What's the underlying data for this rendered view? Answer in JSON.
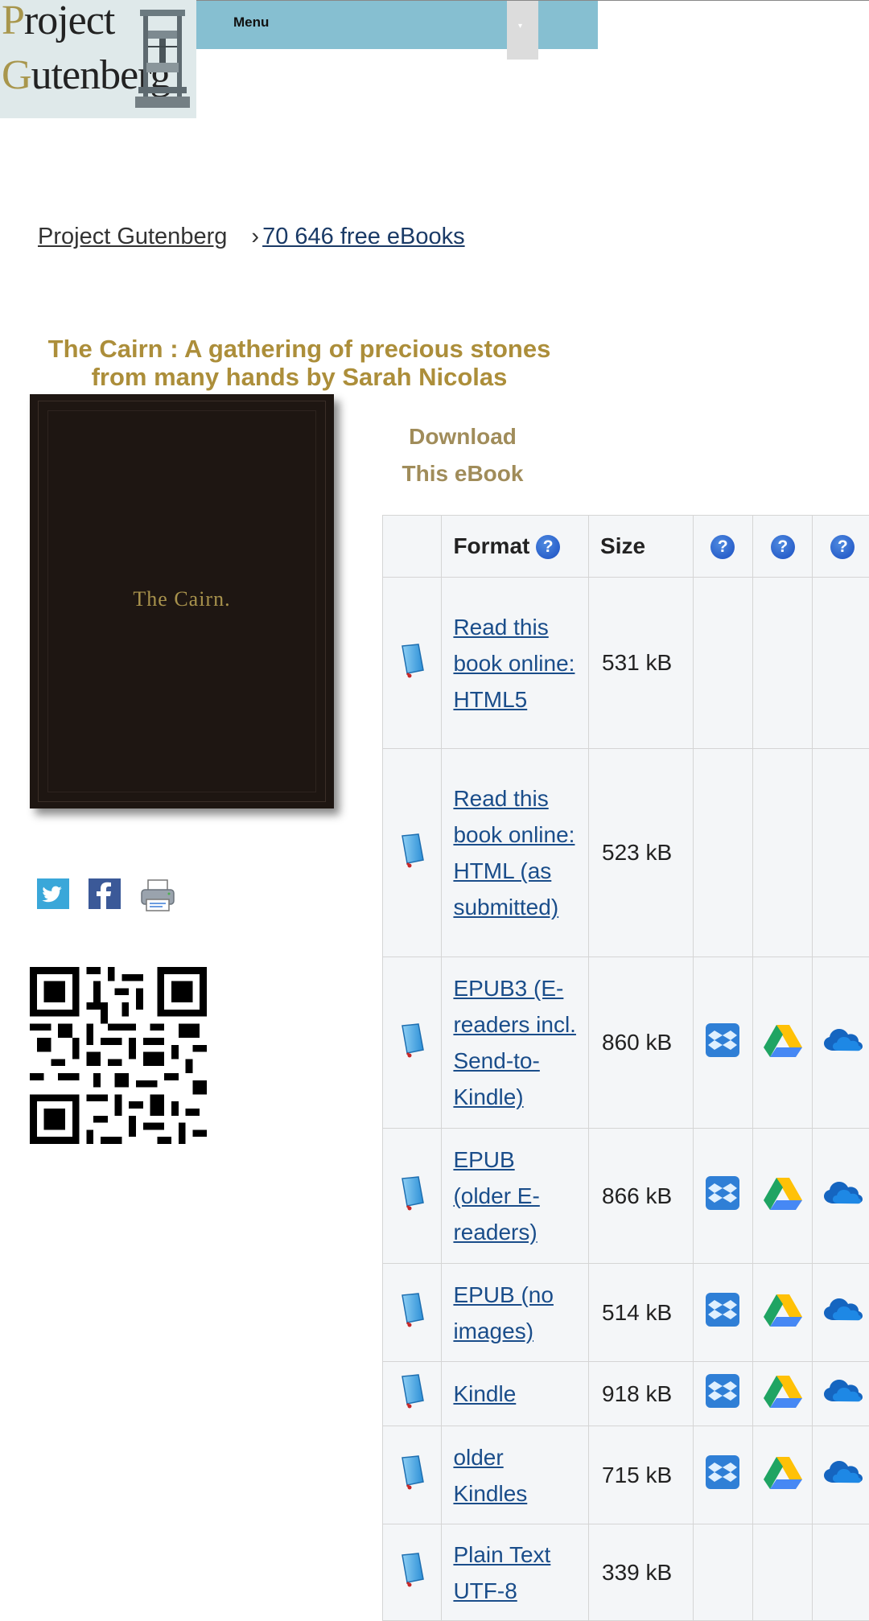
{
  "logo": {
    "line1_cap": "P",
    "line1_rest": "roject",
    "line2_cap": "G",
    "line2_rest": "utenberg"
  },
  "menu": {
    "label": "Menu",
    "dropdown_glyph": "▾"
  },
  "breadcrumb": {
    "home": "Project Gutenberg",
    "separator": "›",
    "count": "70 646 free eBooks"
  },
  "title": "The Cairn : A gathering of precious stones from many hands by Sarah Nicolas",
  "cover": {
    "text": "The Cairn."
  },
  "download": {
    "line1": "Download",
    "line2": "This eBook"
  },
  "table": {
    "headers": {
      "format": "Format",
      "size": "Size",
      "help_glyph": "?"
    },
    "rows": [
      {
        "format": "Read this book online: HTML5",
        "size": "531 kB",
        "cloud": false
      },
      {
        "format": "Read this book online: HTML (as submitted)",
        "size": "523 kB",
        "cloud": false
      },
      {
        "format": "EPUB3 (E-readers incl. Send-to-Kindle)",
        "size": "860 kB",
        "cloud": true
      },
      {
        "format": "EPUB (older E-readers)",
        "size": "866 kB",
        "cloud": true
      },
      {
        "format": "EPUB (no images)",
        "size": "514 kB",
        "cloud": true
      },
      {
        "format": "Kindle",
        "size": "918 kB",
        "cloud": true
      },
      {
        "format": "older Kindles",
        "size": "715 kB",
        "cloud": true
      },
      {
        "format": "Plain Text UTF-8",
        "size": "339 kB",
        "cloud": false
      }
    ]
  },
  "colors": {
    "title": "#ac8e3a",
    "menu_bg": "#86bfd1",
    "link": "#1a4d8a",
    "download": "#a08c5a"
  },
  "icons": [
    "book-icon",
    "help-icon",
    "dropbox-icon",
    "google-drive-icon",
    "onedrive-icon",
    "twitter-icon",
    "facebook-icon",
    "print-icon",
    "qr-code"
  ]
}
